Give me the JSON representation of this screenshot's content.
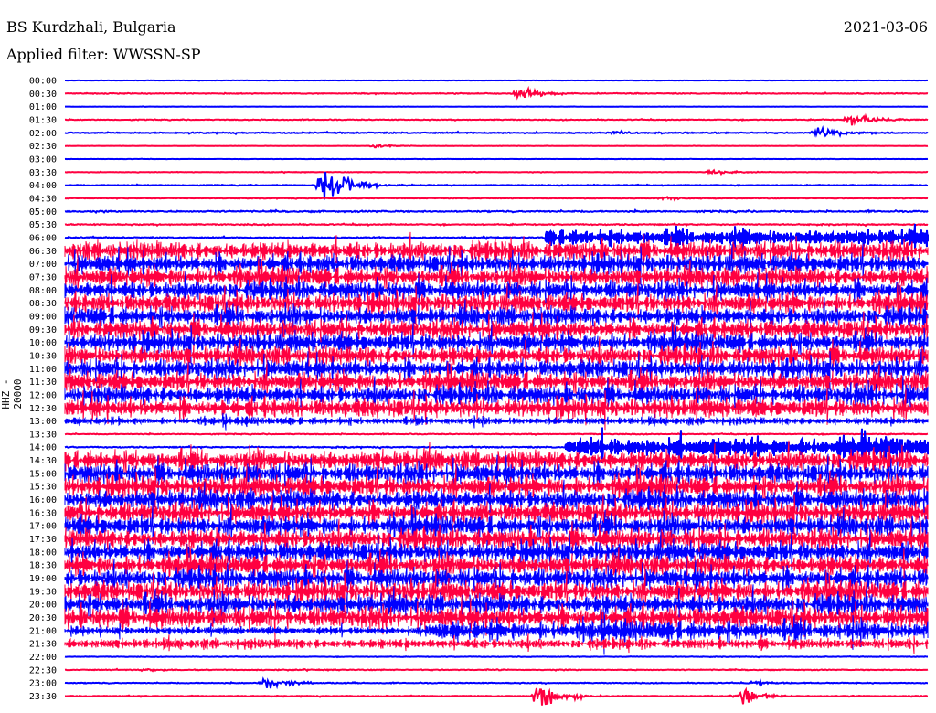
{
  "header": {
    "station": "BS Kurdzhali, Bulgaria",
    "filter": "Applied filter: WWSSN-SP",
    "date": "2021-03-06"
  },
  "chart_data": {
    "type": "line",
    "title": "BS Kurdzhali, Bulgaria",
    "ylabel": "HHZ - 20000",
    "minutes_per_row": 30,
    "colors": [
      "#0000ff",
      "#ff0040"
    ],
    "rows": [
      {
        "time": "00:00",
        "level": 0.01
      },
      {
        "time": "00:30",
        "level": 0.03,
        "events": [
          {
            "minute": 15.8,
            "amp": 0.25
          }
        ]
      },
      {
        "time": "01:00",
        "level": 0.01
      },
      {
        "time": "01:30",
        "level": 0.03,
        "events": [
          {
            "minute": 27.3,
            "amp": 0.3
          }
        ]
      },
      {
        "time": "02:00",
        "level": 0.04,
        "events": [
          {
            "minute": 26.2,
            "amp": 0.25
          },
          {
            "minute": 19.2,
            "amp": 0.1
          }
        ]
      },
      {
        "time": "02:30",
        "level": 0.01,
        "events": [
          {
            "minute": 10.8,
            "amp": 0.08
          }
        ]
      },
      {
        "time": "03:00",
        "level": 0.01
      },
      {
        "time": "03:30",
        "level": 0.02,
        "events": [
          {
            "minute": 22.5,
            "amp": 0.12
          }
        ]
      },
      {
        "time": "04:00",
        "level": 0.03,
        "events": [
          {
            "minute": 9.0,
            "amp": 1.1
          }
        ]
      },
      {
        "time": "04:30",
        "level": 0.02,
        "events": [
          {
            "minute": 20.8,
            "amp": 0.08
          }
        ]
      },
      {
        "time": "05:00",
        "level": 0.05
      },
      {
        "time": "05:30",
        "level": 0.04
      },
      {
        "time": "06:00",
        "level": 0.04,
        "change": {
          "minute": 16.7,
          "level": 0.6
        }
      },
      {
        "time": "06:30",
        "level": 0.75
      },
      {
        "time": "07:00",
        "level": 0.75
      },
      {
        "time": "07:30",
        "level": 0.75
      },
      {
        "time": "08:00",
        "level": 0.75
      },
      {
        "time": "08:30",
        "level": 0.75
      },
      {
        "time": "09:00",
        "level": 0.75
      },
      {
        "time": "09:30",
        "level": 0.75
      },
      {
        "time": "10:00",
        "level": 0.75
      },
      {
        "time": "10:30",
        "level": 0.75
      },
      {
        "time": "11:00",
        "level": 0.75
      },
      {
        "time": "11:30",
        "level": 0.75
      },
      {
        "time": "12:00",
        "level": 0.75,
        "change": {
          "minute": 27.3,
          "level": 0.9
        }
      },
      {
        "time": "12:30",
        "level": 0.75
      },
      {
        "time": "13:00",
        "level": 0.3
      },
      {
        "time": "13:30",
        "level": 0.03
      },
      {
        "time": "14:00",
        "level": 0.04,
        "change": {
          "minute": 17.4,
          "level": 0.7
        }
      },
      {
        "time": "14:30",
        "level": 0.8
      },
      {
        "time": "15:00",
        "level": 0.8
      },
      {
        "time": "15:30",
        "level": 0.8
      },
      {
        "time": "16:00",
        "level": 0.8
      },
      {
        "time": "16:30",
        "level": 0.8
      },
      {
        "time": "17:00",
        "level": 0.8
      },
      {
        "time": "17:30",
        "level": 0.8
      },
      {
        "time": "18:00",
        "level": 0.8
      },
      {
        "time": "18:30",
        "level": 0.8
      },
      {
        "time": "19:00",
        "level": 0.8
      },
      {
        "time": "19:30",
        "level": 0.8
      },
      {
        "time": "20:00",
        "level": 0.8
      },
      {
        "time": "20:30",
        "level": 0.85
      },
      {
        "time": "21:00",
        "level": 0.3,
        "change": {
          "minute": 12.5,
          "level": 0.8
        }
      },
      {
        "time": "21:30",
        "level": 0.4
      },
      {
        "time": "22:00",
        "level": 0.02
      },
      {
        "time": "22:30",
        "level": 0.03,
        "events": [
          {
            "minute": 2.8,
            "amp": 0.06
          }
        ]
      },
      {
        "time": "23:00",
        "level": 0.03,
        "events": [
          {
            "minute": 7.0,
            "amp": 0.3
          },
          {
            "minute": 24.0,
            "amp": 0.1
          }
        ]
      },
      {
        "time": "23:30",
        "level": 0.03,
        "events": [
          {
            "minute": 16.5,
            "amp": 0.6
          },
          {
            "minute": 23.6,
            "amp": 0.3
          }
        ]
      }
    ]
  }
}
